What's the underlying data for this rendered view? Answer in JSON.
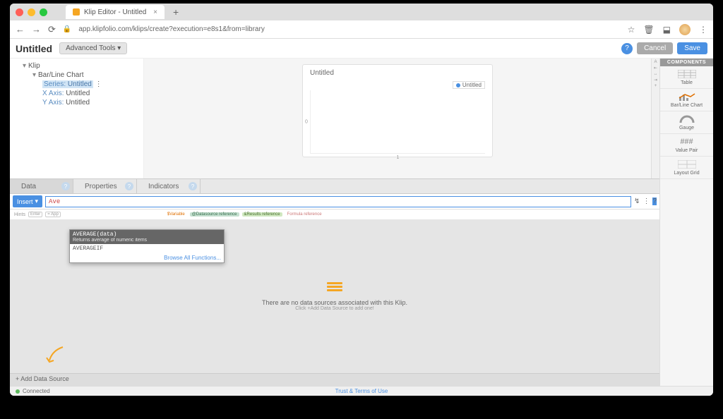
{
  "browser": {
    "tab_title": "Klip Editor - Untitled",
    "url": "app.klipfolio.com/klips/create?execution=e8s1&from=library"
  },
  "app": {
    "title": "Untitled",
    "advanced_tools": "Advanced Tools",
    "cancel": "Cancel",
    "save": "Save"
  },
  "tree": {
    "klip": "Klip",
    "barline": "Bar/Line Chart",
    "series_label": "Series:",
    "series_value": "Untitled",
    "xaxis_label": "X Axis:",
    "xaxis_value": "Untitled",
    "yaxis_label": "Y Axis:",
    "yaxis_value": "Untitled"
  },
  "chart": {
    "title": "Untitled",
    "legend": "Untitled"
  },
  "chart_data": {
    "type": "bar",
    "categories": [
      "1"
    ],
    "values": [
      0
    ],
    "title": "Untitled",
    "xlabel": "",
    "ylabel": "",
    "ylim": [
      0,
      1
    ],
    "y_ticks": [
      "0"
    ],
    "x_ticks": [
      "1"
    ]
  },
  "panel_tabs": {
    "data": "Data",
    "properties": "Properties",
    "indicators": "Indicators"
  },
  "formula": {
    "insert": "Insert",
    "input": "Ave",
    "hints_label": "Hints",
    "enter": "Enter",
    "apply": "= App",
    "variable": "$Variable",
    "datasource": "@Datasource reference",
    "results": "&Results reference",
    "fn": "Formula reference"
  },
  "autocomplete": {
    "selected_sig": "AVERAGE(data)",
    "selected_desc": "Returns average of numeric items",
    "item2": "AVERAGEIF",
    "browse": "Browse All Functions..."
  },
  "datasource": {
    "empty": "There are no data sources associated with this Klip.",
    "hint": "Click +Add Data Source to add one!",
    "add": "+ Add Data Source"
  },
  "components": {
    "header": "COMPONENTS",
    "table": "Table",
    "barline": "Bar/Line Chart",
    "gauge": "Gauge",
    "valuepair": "Value Pair",
    "valuepair_icon": "###",
    "layoutgrid": "Layout Grid"
  },
  "status": {
    "connected": "Connected",
    "terms": "Trust & Terms of Use"
  }
}
